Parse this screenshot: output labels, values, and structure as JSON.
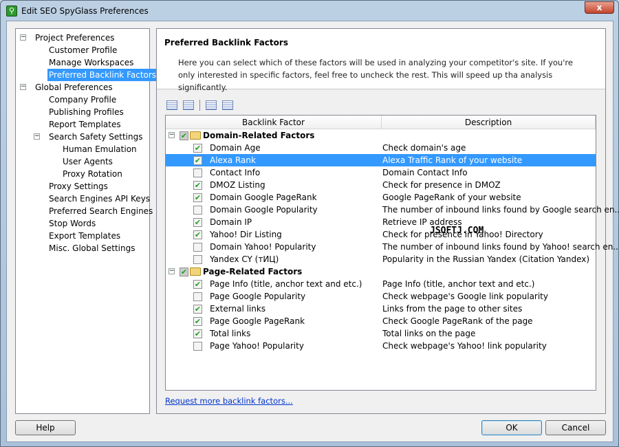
{
  "window": {
    "title": "Edit SEO SpyGlass Preferences",
    "close_label": "x"
  },
  "watermark": "JSOFTJ.COM",
  "tree": [
    {
      "label": "Project Preferences",
      "level": 0,
      "expand": "-"
    },
    {
      "label": "Customer Profile",
      "level": 1
    },
    {
      "label": "Manage Workspaces",
      "level": 1
    },
    {
      "label": "Preferred Backlink Factors",
      "level": 1,
      "selected": true
    },
    {
      "label": "Global Preferences",
      "level": 0,
      "expand": "-"
    },
    {
      "label": "Company Profile",
      "level": 1
    },
    {
      "label": "Publishing Profiles",
      "level": 1
    },
    {
      "label": "Report Templates",
      "level": 1
    },
    {
      "label": "Search Safety Settings",
      "level": 1,
      "expand": "-"
    },
    {
      "label": "Human Emulation",
      "level": 2
    },
    {
      "label": "User Agents",
      "level": 2
    },
    {
      "label": "Proxy Rotation",
      "level": 2
    },
    {
      "label": "Proxy Settings",
      "level": 1
    },
    {
      "label": "Search Engines API Keys",
      "level": 1
    },
    {
      "label": "Preferred Search Engines",
      "level": 1
    },
    {
      "label": "Stop Words",
      "level": 1
    },
    {
      "label": "Export Templates",
      "level": 1
    },
    {
      "label": "Misc. Global Settings",
      "level": 1
    }
  ],
  "panel": {
    "title": "Preferred Backlink Factors",
    "description": "Here you can select which of these factors will be used in analyzing your competitor's site. If you're only interested in specific factors, feel free to uncheck the rest. This will speed up tha analysis significantly.",
    "toolbar": [
      "expand-all-icon",
      "collapse-all-icon",
      "check-all-icon",
      "uncheck-all-icon"
    ],
    "columns": [
      "Backlink Factor",
      "Description"
    ],
    "rows": [
      {
        "group": true,
        "label": "Domain-Related Factors",
        "checked": true
      },
      {
        "label": "Domain Age",
        "desc": "Check domain's age",
        "checked": true
      },
      {
        "label": "Alexa Rank",
        "desc": "Alexa Traffic Rank of your website",
        "checked": true,
        "selected": true
      },
      {
        "label": "Contact Info",
        "desc": "Domain Contact Info",
        "checked": false
      },
      {
        "label": "DMOZ Listing",
        "desc": "Check for presence in DMOZ",
        "checked": true
      },
      {
        "label": "Domain Google PageRank",
        "desc": "Google PageRank of your website",
        "checked": true
      },
      {
        "label": "Domain Google Popularity",
        "desc": "The number of inbound links found by Google search en...",
        "checked": false
      },
      {
        "label": "Domain IP",
        "desc": "Retrieve IP address",
        "checked": true
      },
      {
        "label": "Yahoo! Dir Listing",
        "desc": "Check for presence in Yahoo! Directory",
        "checked": true
      },
      {
        "label": "Domain Yahoo! Popularity",
        "desc": "The number of inbound links found by Yahoo! search en...",
        "checked": false
      },
      {
        "label": "Yandex CY (тИЦ)",
        "desc": "Popularity in the Russian Yandex (Citation Yandex)",
        "checked": false
      },
      {
        "group": true,
        "label": "Page-Related Factors",
        "checked": true
      },
      {
        "label": "Page Info (title, anchor text and etc.)",
        "desc": "Page Info (title, anchor text and etc.)",
        "checked": true
      },
      {
        "label": "Page Google Popularity",
        "desc": "Check webpage's Google link popularity",
        "checked": false
      },
      {
        "label": "External links",
        "desc": "Links from the page to other sites",
        "checked": true
      },
      {
        "label": "Page Google PageRank",
        "desc": "Check Google PageRank of the page",
        "checked": true
      },
      {
        "label": "Total links",
        "desc": "Total links on the page",
        "checked": true
      },
      {
        "label": "Page Yahoo! Popularity",
        "desc": "Check webpage's Yahoo! link popularity",
        "checked": false
      }
    ],
    "link": "Request more backlink factors..."
  },
  "buttons": {
    "help": "Help",
    "ok": "OK",
    "cancel": "Cancel"
  }
}
